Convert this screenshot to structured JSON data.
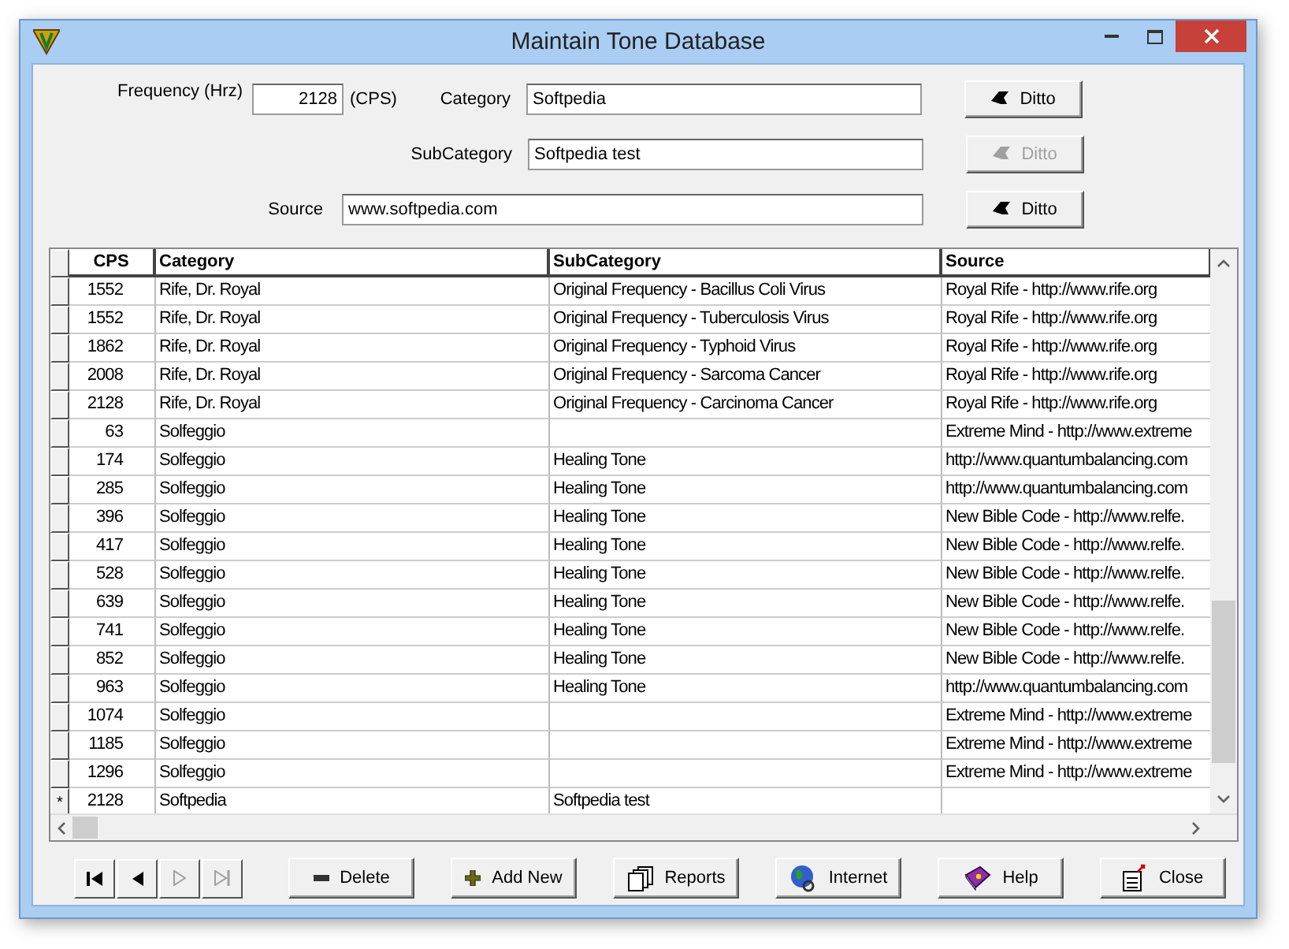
{
  "window": {
    "title": "Maintain Tone Database"
  },
  "form": {
    "frequency_label": "Frequency (Hrz)",
    "frequency_value": "2128",
    "frequency_unit": "(CPS)",
    "fields": [
      {
        "label": "Category",
        "value": "Softpedia",
        "ditto": {
          "label": "Ditto",
          "disabled": false
        }
      },
      {
        "label": "SubCategory",
        "value": "Softpedia test",
        "ditto": {
          "label": "Ditto",
          "disabled": true
        }
      },
      {
        "label": "Source",
        "value": "www.softpedia.com",
        "ditto": {
          "label": "Ditto",
          "disabled": false
        }
      }
    ]
  },
  "table": {
    "columns": [
      "CPS",
      "Category",
      "SubCategory",
      "Source"
    ],
    "rows": [
      {
        "cps": "1552",
        "category": "Rife, Dr. Royal",
        "subcategory": "Original Frequency - Bacillus Coli Virus",
        "source": "Royal Rife - http://www.rife.org"
      },
      {
        "cps": "1552",
        "category": "Rife, Dr. Royal",
        "subcategory": "Original Frequency - Tuberculosis Virus",
        "source": "Royal Rife - http://www.rife.org"
      },
      {
        "cps": "1862",
        "category": "Rife, Dr. Royal",
        "subcategory": "Original Frequency - Typhoid Virus",
        "source": "Royal Rife - http://www.rife.org"
      },
      {
        "cps": "2008",
        "category": "Rife, Dr. Royal",
        "subcategory": "Original Frequency - Sarcoma Cancer",
        "source": "Royal Rife - http://www.rife.org"
      },
      {
        "cps": "2128",
        "category": "Rife, Dr. Royal",
        "subcategory": "Original Frequency - Carcinoma Cancer",
        "source": "Royal Rife - http://www.rife.org"
      },
      {
        "cps": "63",
        "category": "Solfeggio",
        "source": "Extreme Mind - http://www.extreme"
      },
      {
        "cps": "174",
        "category": "Solfeggio",
        "subcategory": "Healing Tone",
        "source": "http://www.quantumbalancing.com"
      },
      {
        "cps": "285",
        "category": "Solfeggio",
        "subcategory": "Healing Tone",
        "source": "http://www.quantumbalancing.com"
      },
      {
        "cps": "396",
        "category": "Solfeggio",
        "subcategory": "Healing Tone",
        "source": "New Bible Code - http://www.relfe."
      },
      {
        "cps": "417",
        "category": "Solfeggio",
        "subcategory": "Healing Tone",
        "source": "New Bible Code - http://www.relfe."
      },
      {
        "cps": "528",
        "category": "Solfeggio",
        "subcategory": "Healing Tone",
        "source": "New Bible Code - http://www.relfe."
      },
      {
        "cps": "639",
        "category": "Solfeggio",
        "subcategory": "Healing Tone",
        "source": "New Bible Code - http://www.relfe."
      },
      {
        "cps": "741",
        "category": "Solfeggio",
        "subcategory": "Healing Tone",
        "source": "New Bible Code - http://www.relfe."
      },
      {
        "cps": "852",
        "category": "Solfeggio",
        "subcategory": "Healing Tone",
        "source": "New Bible Code - http://www.relfe."
      },
      {
        "cps": "963",
        "category": "Solfeggio",
        "subcategory": "Healing Tone",
        "source": "http://www.quantumbalancing.com"
      },
      {
        "cps": "1074",
        "category": "Solfeggio",
        "source": "Extreme Mind - http://www.extreme"
      },
      {
        "cps": "1185",
        "category": "Solfeggio",
        "source": "Extreme Mind - http://www.extreme"
      },
      {
        "cps": "1296",
        "category": "Solfeggio",
        "source": "Extreme Mind - http://www.extreme"
      },
      {
        "marker": "*",
        "cps": "2128",
        "category": "Softpedia",
        "subcategory": "Softpedia test"
      }
    ]
  },
  "navigation": [
    {
      "kind": "first",
      "disabled": false
    },
    {
      "kind": "prev",
      "disabled": false
    },
    {
      "kind": "next",
      "disabled": true
    },
    {
      "kind": "last",
      "disabled": true
    }
  ],
  "buttons": [
    {
      "kind": "delete",
      "label": "Delete"
    },
    {
      "kind": "add",
      "label": "Add New"
    },
    {
      "kind": "reports",
      "label": "Reports"
    },
    {
      "kind": "internet",
      "label": "Internet"
    },
    {
      "kind": "help",
      "label": "Help"
    },
    {
      "kind": "close",
      "label": "Close"
    }
  ]
}
